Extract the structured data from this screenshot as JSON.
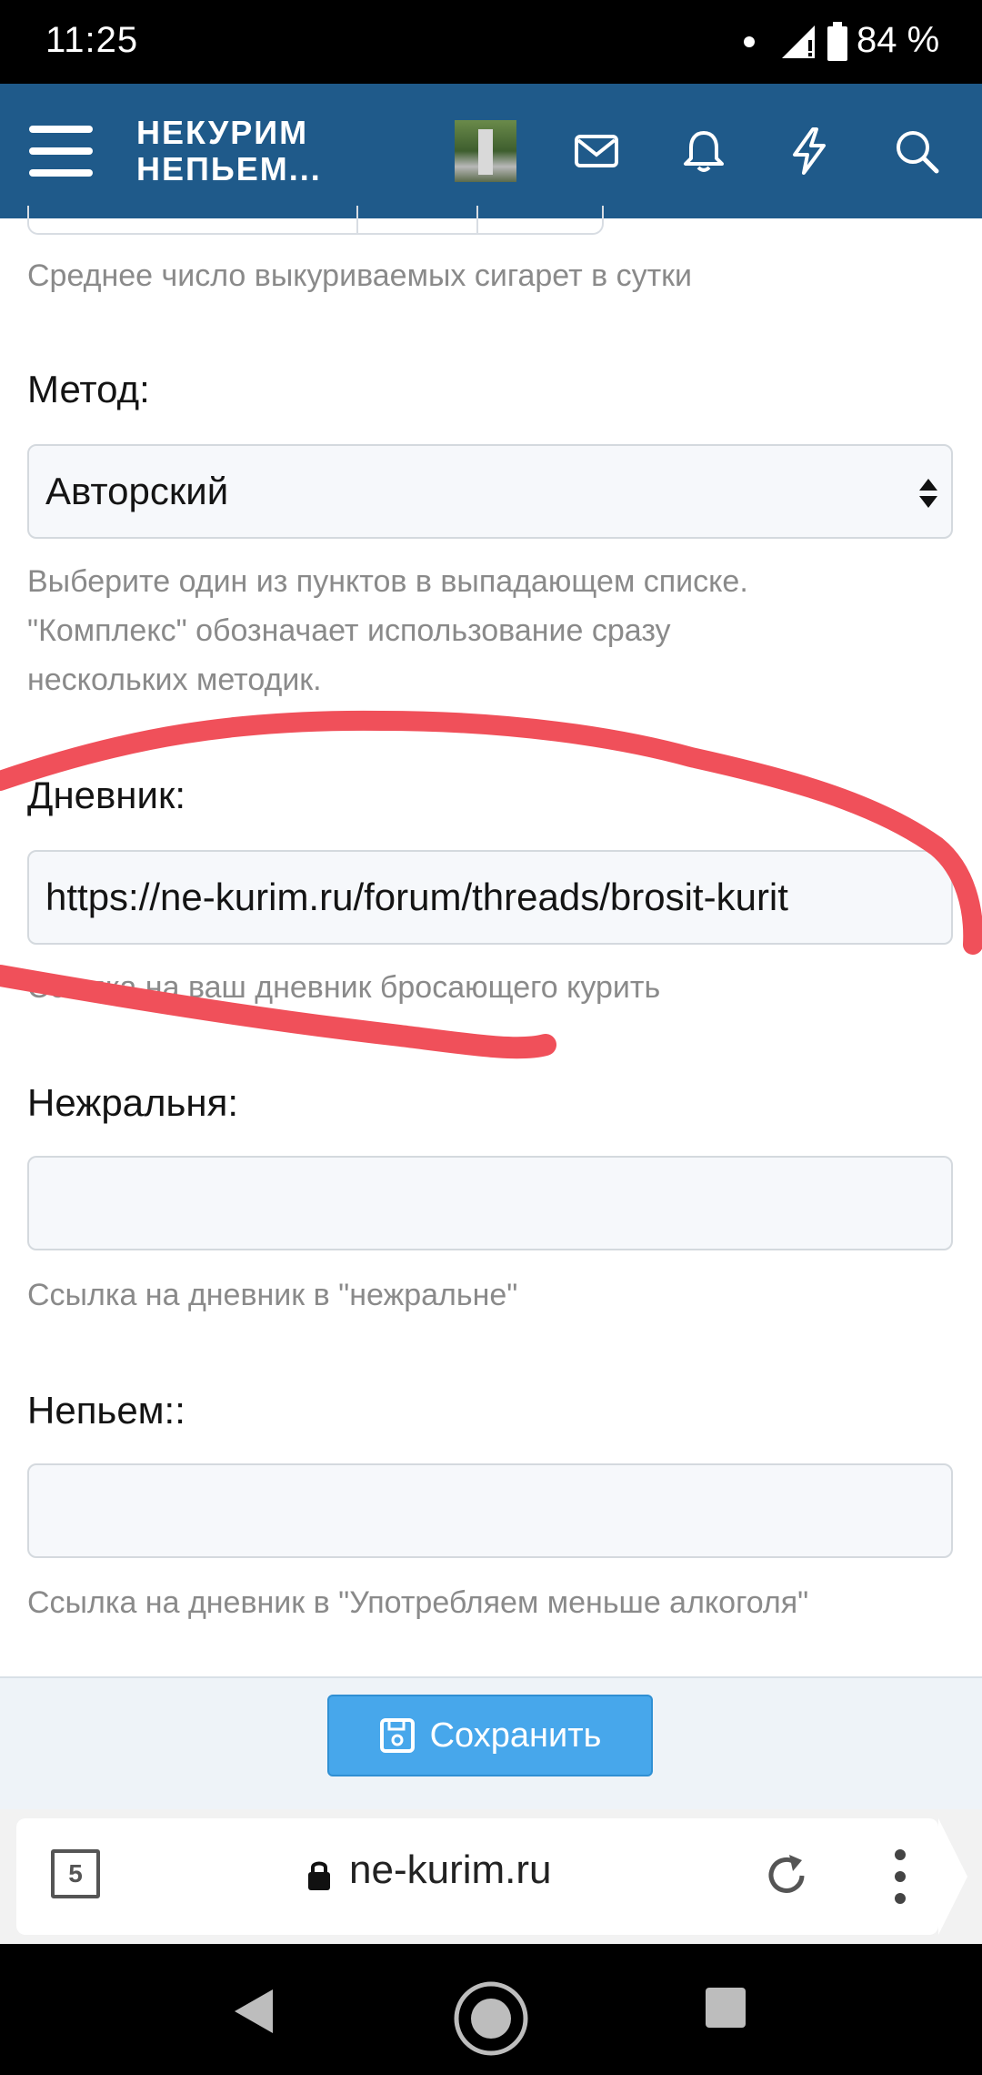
{
  "status_bar": {
    "time": "11:25",
    "battery": "84 %"
  },
  "header": {
    "logo_line1": "НЕКУРИМ",
    "logo_line2": "НЕПЬЕМ..."
  },
  "form": {
    "cigarettes_hint": "Среднее число выкуриваемых сигарет в сутки",
    "method": {
      "label": "Метод:",
      "value": "Авторский",
      "hint_line1": "Выберите один из пунктов в выпадающем списке.",
      "hint_line2": "\"Комплекс\" обозначает использование сразу",
      "hint_line3": "нескольких методик."
    },
    "diary": {
      "label": "Дневник:",
      "value": "https://ne-kurim.ru/forum/threads/brosit-kurit",
      "hint": "Ссылка на ваш дневник бросающего курить"
    },
    "nezhralnya": {
      "label": "Нежральня:",
      "value": "",
      "hint": "Ссылка на дневник в \"нежральне\""
    },
    "nepyem": {
      "label": "Непьем::",
      "value": "",
      "hint": "Ссылка на дневник в \"Употребляем меньше алкоголя\""
    }
  },
  "save_button": {
    "label": "Сохранить"
  },
  "browser": {
    "tab_count": "5",
    "url": "ne-kurim.ru"
  },
  "colors": {
    "header": "#1f5a8a",
    "save_button": "#47a7eb",
    "annotation": "#f0505a"
  }
}
